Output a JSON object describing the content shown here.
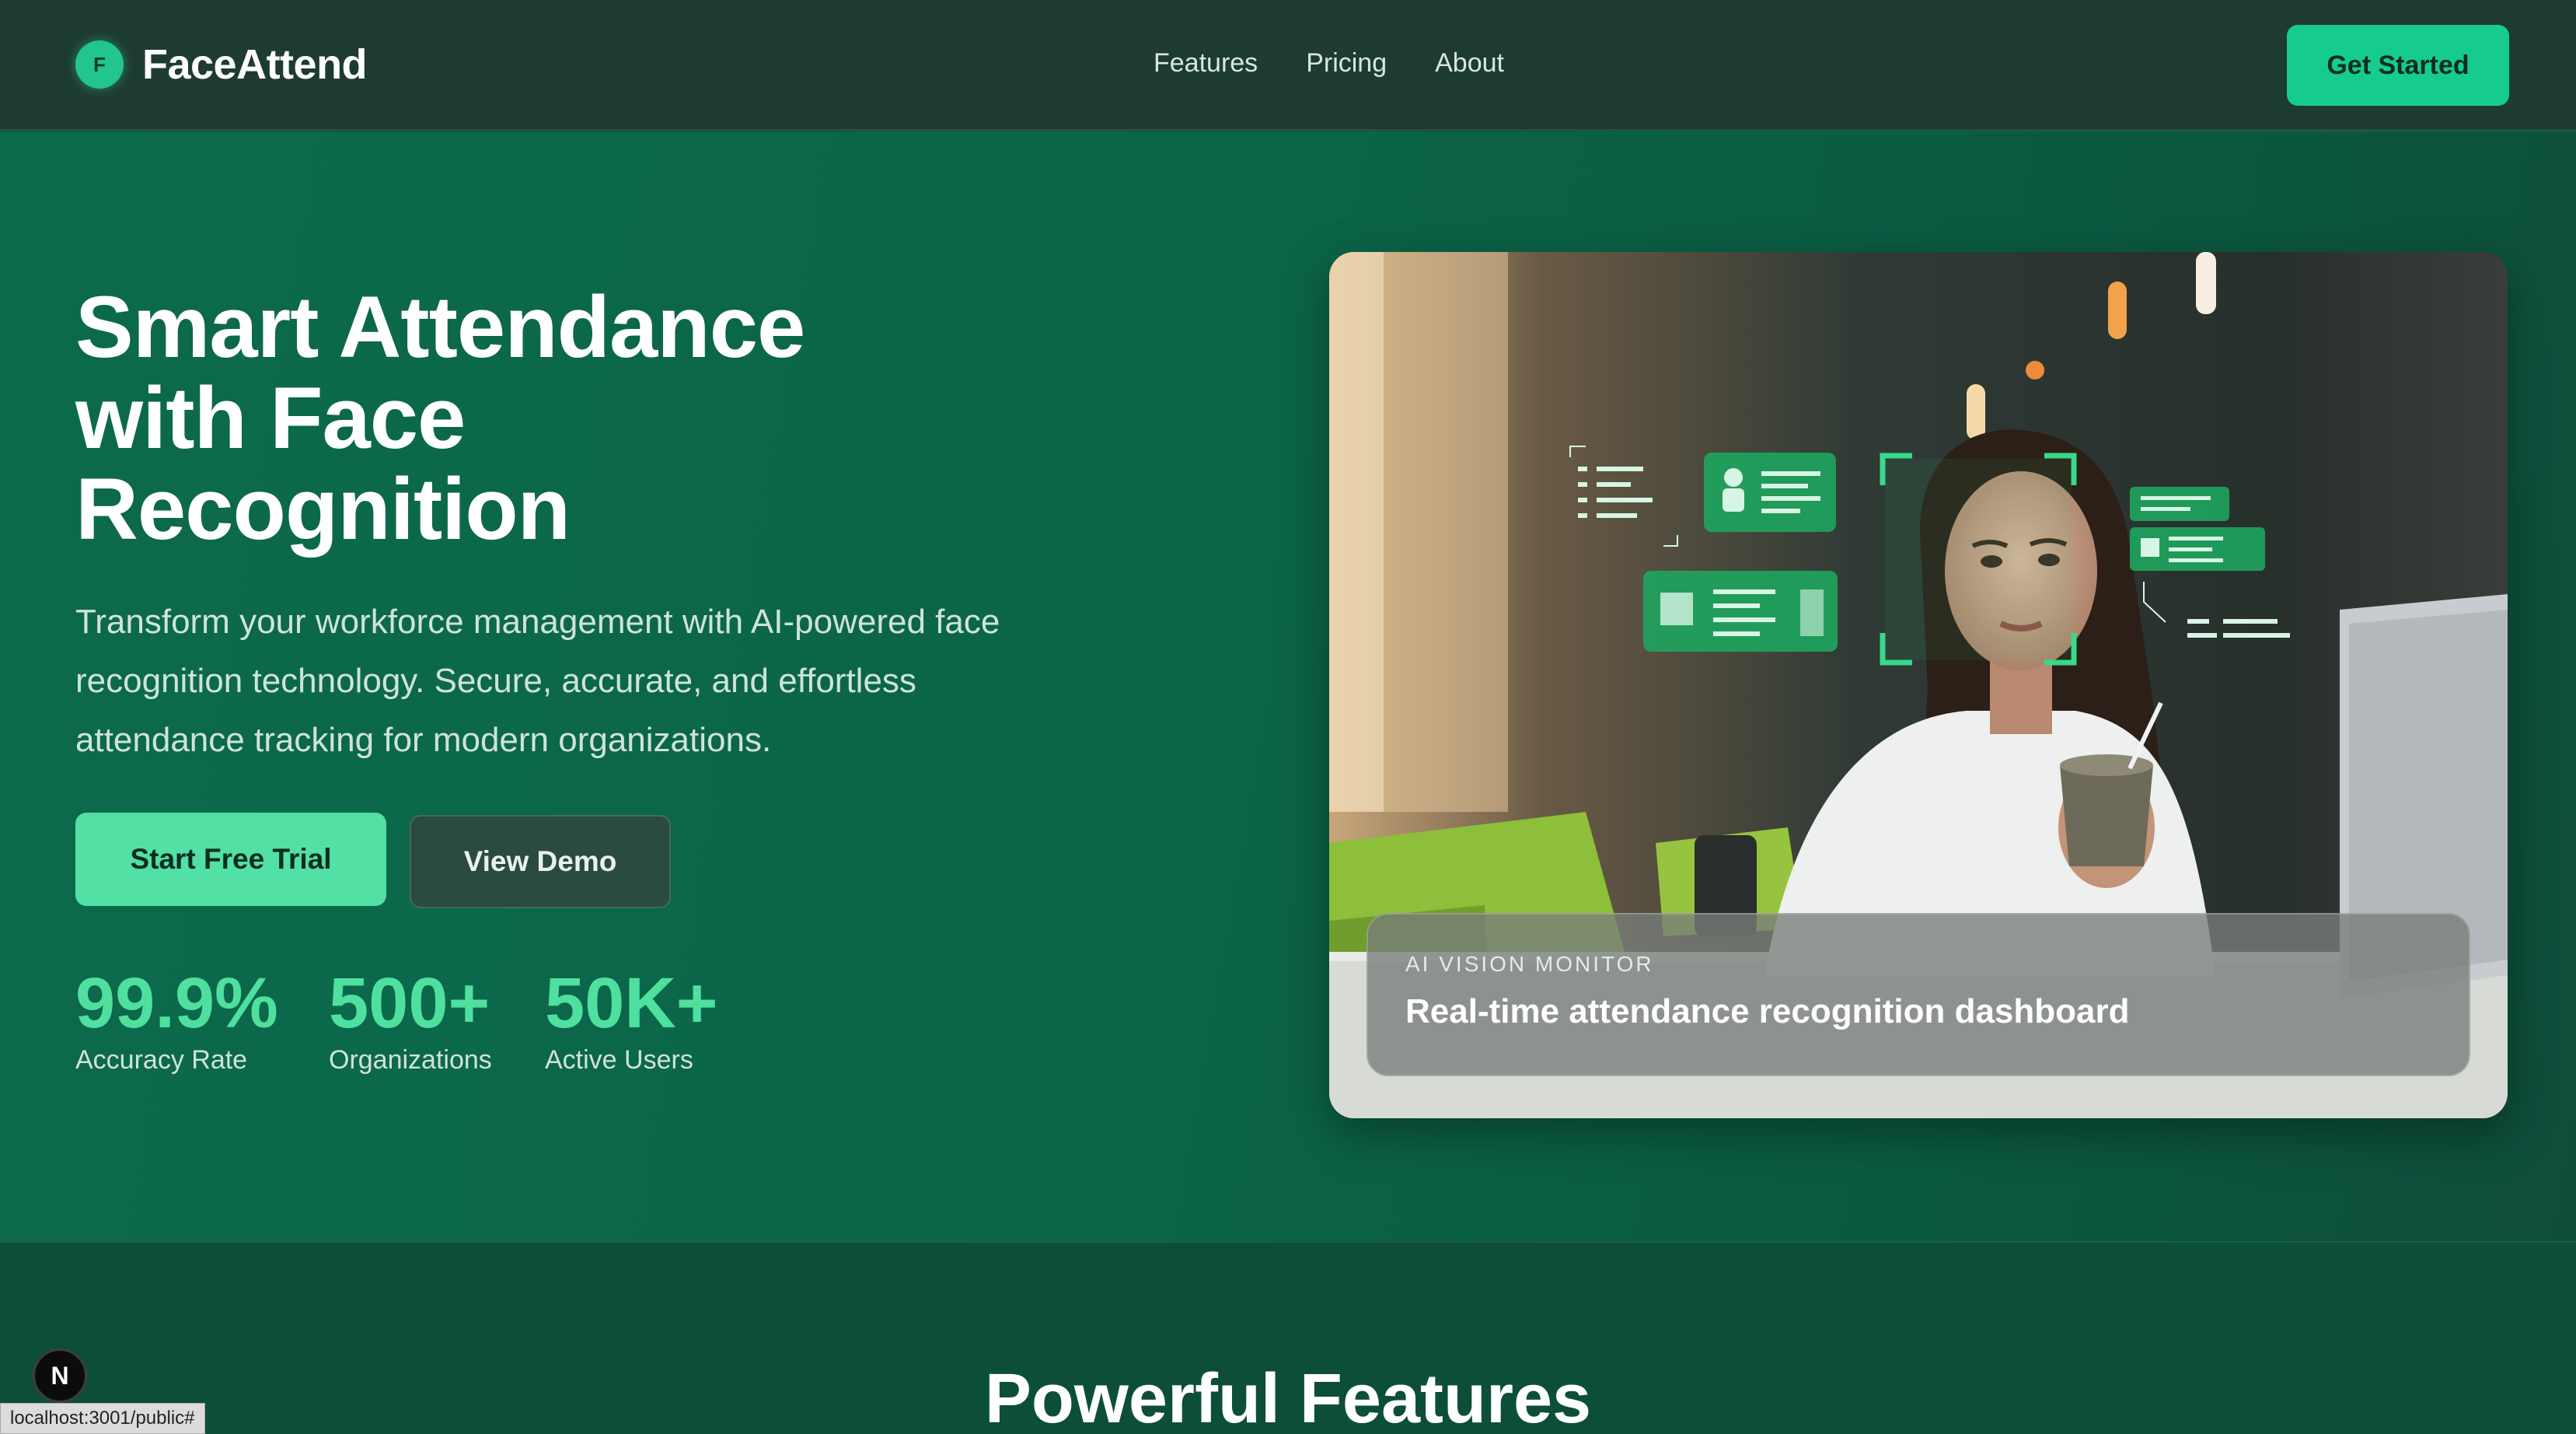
{
  "brand": {
    "logo_letter": "F",
    "name": "FaceAttend",
    "accent": "#15cc8c"
  },
  "nav": {
    "links": [
      "Features",
      "Pricing",
      "About"
    ],
    "cta_label": "Get Started"
  },
  "hero": {
    "title_lines": [
      "Smart Attendance",
      "with Face",
      "Recognition"
    ],
    "subtitle_lines": [
      "Transform your workforce management with AI-powered face",
      "recognition technology. Secure, accurate, and effortless",
      "attendance tracking for modern organizations."
    ],
    "primary_button": "Start Free Trial",
    "secondary_button": "View Demo",
    "stats": [
      {
        "value": "99.9%",
        "label": "Accuracy Rate"
      },
      {
        "value": "500+",
        "label": "Organizations"
      },
      {
        "value": "50K+",
        "label": "Active Users"
      }
    ],
    "image_caption": {
      "label": "AI VISION MONITOR",
      "text": "Real-time attendance recognition dashboard"
    }
  },
  "features": {
    "title": "Powerful Features"
  },
  "dev": {
    "next_badge": "N",
    "status_url": "localhost:3001/public#"
  }
}
